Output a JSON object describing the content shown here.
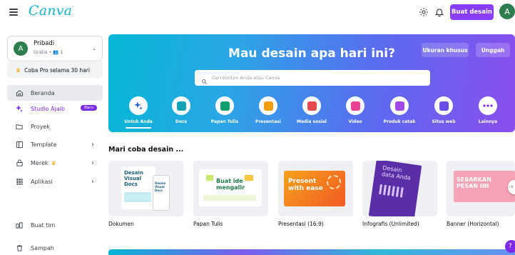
{
  "header": {
    "logo_text": "Canva",
    "create_button": "Buat desain",
    "avatar_initial": "A",
    "icons": [
      "hamburger-menu-icon",
      "gear-icon",
      "bell-icon"
    ]
  },
  "sidebar": {
    "account": {
      "name": "Pribadi",
      "sub": "Gratis • 👥 1",
      "avatar_initial": "A"
    },
    "pro_cta": "Coba Pro selama 30 hari",
    "items": [
      {
        "label": "Beranda",
        "icon": "home-icon",
        "active": true
      },
      {
        "label": "Studio Ajaib",
        "icon": "magic-sparkle-icon",
        "badge": "Baru"
      },
      {
        "label": "Proyek",
        "icon": "folder-icon"
      },
      {
        "label": "Template",
        "icon": "template-icon"
      },
      {
        "label": "Merek",
        "icon": "brand-icon"
      },
      {
        "label": "Aplikasi",
        "icon": "apps-grid-icon"
      }
    ],
    "bottom_items": [
      {
        "label": "Buat tim",
        "icon": "team-icon"
      },
      {
        "label": "Sampah",
        "icon": "trash-icon"
      }
    ]
  },
  "hero": {
    "title": "Mau desain apa hari ini?",
    "custom_size_button": "Ukuran khusus",
    "upload_button": "Unggah",
    "search_placeholder": "Cari konten Anda atau Canva",
    "categories": [
      {
        "label": "Untuk Anda",
        "icon": "sparkle-icon",
        "color": "#1e5bd6",
        "selected": true
      },
      {
        "label": "Docs",
        "icon": "docs-icon",
        "color": "#13a3b5"
      },
      {
        "label": "Papan Tulis",
        "icon": "whiteboard-icon",
        "color": "#0d9f6e"
      },
      {
        "label": "Presentasi",
        "icon": "presentation-icon",
        "color": "#f39c12"
      },
      {
        "label": "Media sosial",
        "icon": "heart-social-icon",
        "color": "#e5484d"
      },
      {
        "label": "Video",
        "icon": "video-icon",
        "color": "#e84393"
      },
      {
        "label": "Produk cetak",
        "icon": "print-icon",
        "color": "#a149e8"
      },
      {
        "label": "Situs web",
        "icon": "website-icon",
        "color": "#6b4ee8"
      },
      {
        "label": "Lainnya",
        "icon": "more-dots-icon",
        "color": "#7d2ae8"
      }
    ]
  },
  "section": {
    "title": "Mari coba desain ...",
    "tiles": [
      {
        "label": "Dokumen",
        "thumb_text": "Desain Visual Docs",
        "thumb_text2": "Desain Visual Docs"
      },
      {
        "label": "Papan Tulis",
        "thumb_text": "Buat ide mengalir"
      },
      {
        "label": "Presentasi (16:9)",
        "thumb_text": "Present with ease"
      },
      {
        "label": "Infografis (Unlimited)",
        "thumb_text": "Desain data Anda"
      },
      {
        "label": "Banner (Horizontal)",
        "thumb_text": "SEBARKAN PESAN INI"
      }
    ]
  },
  "help_label": "?"
}
